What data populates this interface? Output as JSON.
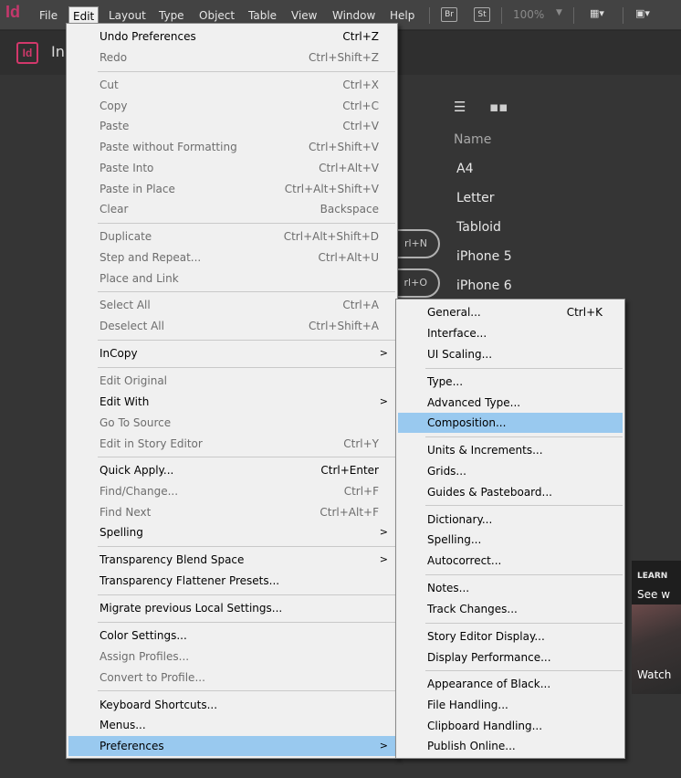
{
  "app": {
    "logo": "Id",
    "badge": "Id",
    "title_fragment": "In"
  },
  "menubar": {
    "items": [
      "File",
      "Edit",
      "Layout",
      "Type",
      "Object",
      "Table",
      "View",
      "Window",
      "Help"
    ],
    "bridge_label": "Br",
    "stock_label": "St",
    "zoom": "100%"
  },
  "workspace": {
    "column_header": "Name",
    "presets": [
      "A4",
      "Letter",
      "Tabloid",
      "iPhone 5",
      "iPhone 6"
    ],
    "shortcut_new": "rl+N",
    "shortcut_open": "rl+O",
    "learn_tag": "LEARN",
    "learn_see": "See w",
    "learn_watch": "Watch"
  },
  "edit_menu": {
    "items": [
      {
        "label": "Undo Preferences",
        "shortcut": "Ctrl+Z"
      },
      {
        "label": "Redo",
        "shortcut": "Ctrl+Shift+Z"
      },
      {
        "label": "Cut",
        "shortcut": "Ctrl+X"
      },
      {
        "label": "Copy",
        "shortcut": "Ctrl+C"
      },
      {
        "label": "Paste",
        "shortcut": "Ctrl+V"
      },
      {
        "label": "Paste without Formatting",
        "shortcut": "Ctrl+Shift+V"
      },
      {
        "label": "Paste Into",
        "shortcut": "Ctrl+Alt+V"
      },
      {
        "label": "Paste in Place",
        "shortcut": "Ctrl+Alt+Shift+V"
      },
      {
        "label": "Clear",
        "shortcut": "Backspace"
      },
      {
        "label": "Duplicate",
        "shortcut": "Ctrl+Alt+Shift+D"
      },
      {
        "label": "Step and Repeat...",
        "shortcut": "Ctrl+Alt+U"
      },
      {
        "label": "Place and Link",
        "shortcut": ""
      },
      {
        "label": "Select All",
        "shortcut": "Ctrl+A"
      },
      {
        "label": "Deselect All",
        "shortcut": "Ctrl+Shift+A"
      },
      {
        "label": "InCopy",
        "shortcut": ""
      },
      {
        "label": "Edit Original",
        "shortcut": ""
      },
      {
        "label": "Edit With",
        "shortcut": ""
      },
      {
        "label": "Go To Source",
        "shortcut": ""
      },
      {
        "label": "Edit in Story Editor",
        "shortcut": "Ctrl+Y"
      },
      {
        "label": "Quick Apply...",
        "shortcut": "Ctrl+Enter"
      },
      {
        "label": "Find/Change...",
        "shortcut": "Ctrl+F"
      },
      {
        "label": "Find Next",
        "shortcut": "Ctrl+Alt+F"
      },
      {
        "label": "Spelling",
        "shortcut": ""
      },
      {
        "label": "Transparency Blend Space",
        "shortcut": ""
      },
      {
        "label": "Transparency Flattener Presets...",
        "shortcut": ""
      },
      {
        "label": "Migrate previous Local Settings...",
        "shortcut": ""
      },
      {
        "label": "Color Settings...",
        "shortcut": ""
      },
      {
        "label": "Assign Profiles...",
        "shortcut": ""
      },
      {
        "label": "Convert to Profile...",
        "shortcut": ""
      },
      {
        "label": "Keyboard Shortcuts...",
        "shortcut": ""
      },
      {
        "label": "Menus...",
        "shortcut": ""
      },
      {
        "label": "Preferences",
        "shortcut": ""
      }
    ]
  },
  "preferences_menu": {
    "items": [
      {
        "label": "General...",
        "shortcut": "Ctrl+K"
      },
      {
        "label": "Interface..."
      },
      {
        "label": "UI Scaling..."
      },
      {
        "label": "Type..."
      },
      {
        "label": "Advanced Type..."
      },
      {
        "label": "Composition..."
      },
      {
        "label": "Units & Increments..."
      },
      {
        "label": "Grids..."
      },
      {
        "label": "Guides & Pasteboard..."
      },
      {
        "label": "Dictionary..."
      },
      {
        "label": "Spelling..."
      },
      {
        "label": "Autocorrect..."
      },
      {
        "label": "Notes..."
      },
      {
        "label": "Track Changes..."
      },
      {
        "label": "Story Editor Display..."
      },
      {
        "label": "Display Performance..."
      },
      {
        "label": "Appearance of Black..."
      },
      {
        "label": "File Handling..."
      },
      {
        "label": "Clipboard Handling..."
      },
      {
        "label": "Publish Online..."
      }
    ]
  },
  "colors": {
    "menu_bg": "#f0f0f0",
    "highlight": "#99c9ef",
    "disabled_text": "#6d6d6d",
    "brand": "#d2386b"
  }
}
